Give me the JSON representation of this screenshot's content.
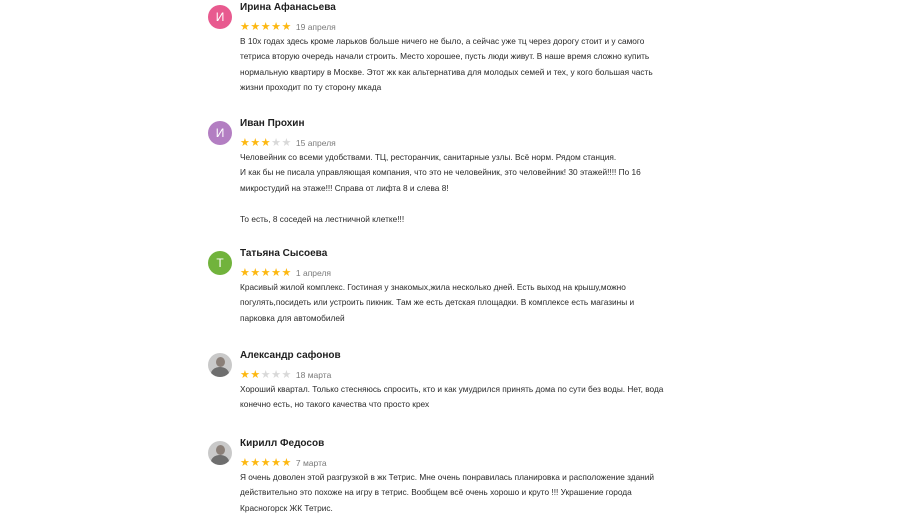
{
  "colors": {
    "star_filled": "#fdb812",
    "star_empty": "#d9d9d9"
  },
  "reviews": [
    {
      "author": "Ирина Афанасьева",
      "avatar": {
        "type": "initial",
        "letter": "И",
        "color": "#e85a8f"
      },
      "rating": 5,
      "date": "19 апреля",
      "text_lines": [
        "В 10х годах здесь кроме ларьков больше ничего не было, а сейчас уже тц через дорогу стоит и у самого",
        "тетриса вторую очередь начали строить. Место хорошее, пусть люди живут. В наше время сложно купить",
        "нормальную квартиру в Москве. Этот жк как альтернатива для молодых семей и тех, у кого большая часть",
        "жизни проходит по ту сторону мкада"
      ]
    },
    {
      "author": "Иван Прохин",
      "avatar": {
        "type": "initial",
        "letter": "И",
        "color": "#b37ec2"
      },
      "rating": 3,
      "date": "15 апреля",
      "text_lines": [
        "Человейник со всеми удобствами. ТЦ, ресторанчик, санитарные узлы. Всё норм. Рядом станция.",
        "И как бы не писала управляющая компания, что это не человейник, это человейник! 30 этажей!!!! По 16",
        "микростудий на этаже!!! Справа от лифта 8 и слева 8!",
        "",
        "То есть, 8 соседей на лестничной клетке!!!"
      ]
    },
    {
      "author": "Татьяна Сысоева",
      "avatar": {
        "type": "initial",
        "letter": "Т",
        "color": "#71b33c"
      },
      "rating": 5,
      "date": "1 апреля",
      "text_lines": [
        "Красивый жилой комплекс. Гостиная у знакомых,жила несколько дней. Есть выход на крышу,можно",
        "погулять,посидеть или устроить пикник. Там же есть детская площадки. В комплексе есть магазины и",
        "парковка для автомобилей"
      ]
    },
    {
      "author": "Александр сафонов",
      "avatar": {
        "type": "photo"
      },
      "rating": 2,
      "date": "18 марта",
      "text_lines": [
        "Хороший квартал. Только стесняюсь спросить, кто и как умудрился принять дома по сути без воды. Нет, вода",
        "конечно есть, но такого качества что просто крех"
      ]
    },
    {
      "author": "Кирилл Федосов",
      "avatar": {
        "type": "photo"
      },
      "rating": 5,
      "date": "7 марта",
      "text_lines": [
        "Я очень доволен этой разгрузкой в жк Тетрис. Мне очень понравилась планировка и расположение зданий",
        "действительно это похоже на игру в тетрис. Вообщем всё очень хорошо и круто !!! Украшение города",
        "Красногорск ЖК Тетрис."
      ]
    }
  ]
}
